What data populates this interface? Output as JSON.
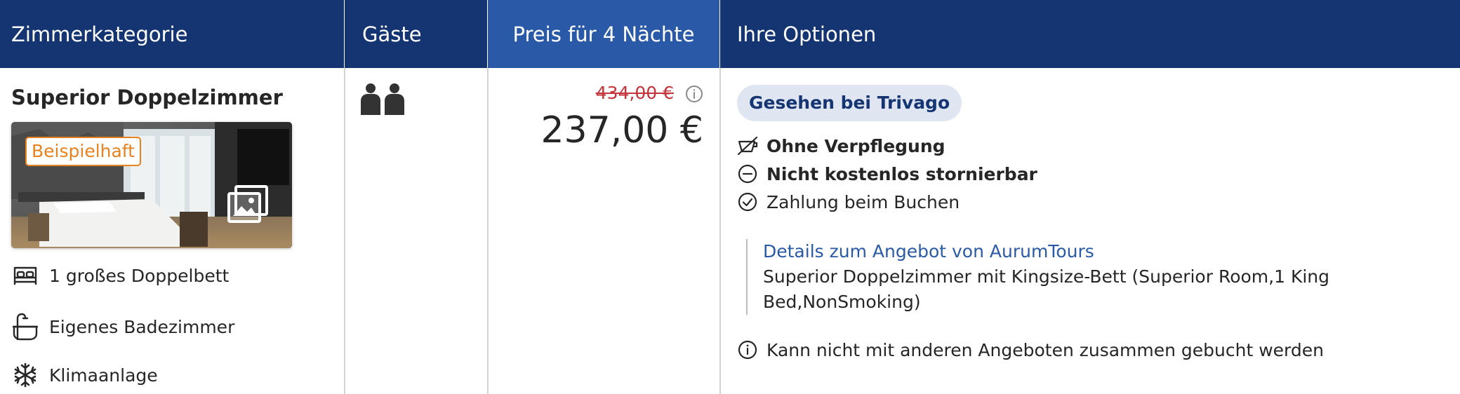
{
  "header": {
    "col_room": "Zimmerkategorie",
    "col_guests": "Gäste",
    "col_price": "Preis für 4 Nächte",
    "col_options": "Ihre Optionen"
  },
  "room": {
    "title": "Superior Doppelzimmer",
    "photo_badge": "Beispielhaft",
    "amenities": [
      {
        "icon": "bed-icon",
        "label": "1 großes Doppelbett"
      },
      {
        "icon": "bathroom-icon",
        "label": "Eigenes Badezimmer"
      },
      {
        "icon": "snowflake-icon",
        "label": "Klimaanlage"
      }
    ]
  },
  "guests": {
    "count": 2,
    "icon": "two-persons-icon"
  },
  "price": {
    "old": "434,00 €",
    "current": "237,00 €",
    "old_color": "#c5343a"
  },
  "options": {
    "source_badge": "Gesehen bei Trivago",
    "items": [
      {
        "icon": "no-meal-icon",
        "label": "Ohne Verpflegung",
        "bold": true
      },
      {
        "icon": "minus-circle-icon",
        "label": "Nicht kostenlos stornierbar",
        "bold": true
      },
      {
        "icon": "check-circle-icon",
        "label": "Zahlung beim Buchen",
        "bold": false
      }
    ],
    "details_link": "Details zum Angebot von AurumTours",
    "details_text": "Superior Doppelzimmer mit Kingsize-Bett (Superior Room,1 King Bed,NonSmoking)",
    "note": "Kann nicht mit anderen Angeboten zusammen gebucht werden"
  },
  "colors": {
    "header_bg": "#143571",
    "header_active_bg": "#2a5aa7",
    "link": "#2a5aa7",
    "badge_orange": "#e8821e"
  }
}
